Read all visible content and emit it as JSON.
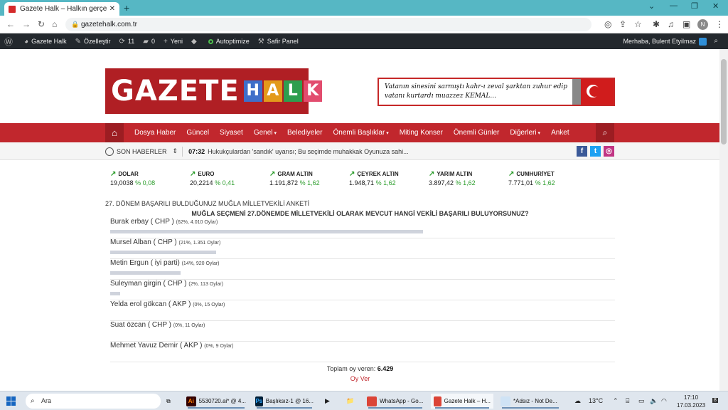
{
  "browser": {
    "tab_title": "Gazete Halk – Halkın gerçek sesi",
    "url": "gazetehalk.com.tr",
    "profile_initial": "N"
  },
  "wpbar": {
    "site": "Gazete Halk",
    "customize": "Özelleştir",
    "updates": "11",
    "comments": "0",
    "new": "Yeni",
    "autoptimize": "Autoptimize",
    "safir": "Safir Panel",
    "greeting": "Merhaba, Bulent Etyilmaz"
  },
  "logo": {
    "word1": "GAZETE",
    "letters": [
      "H",
      "A",
      "L",
      "K"
    ],
    "letter_colors": [
      "#3f6fc9",
      "#e39a1b",
      "#2e9e4f",
      "#e24c6e"
    ]
  },
  "banner": {
    "text": "Vatanın sinesini sarmıştı kahr-ı zeval şarktan zuhur edip vatanı kurtardı muazzez KEMAL..."
  },
  "nav": {
    "items": [
      "Dosya Haber",
      "Güncel",
      "Siyaset",
      "Genel",
      "Belediyeler",
      "Önemli Başlıklar",
      "Miting Konser",
      "Önemli Günler",
      "Diğerleri",
      "Anket"
    ],
    "dropdown_items": [
      "Genel",
      "Önemli Başlıklar",
      "Diğerleri"
    ]
  },
  "ticker": {
    "label": "SON HABERLER",
    "time": "07:32",
    "headline": "Hukukçulardan 'sandık' uyarısı; Bu seçimde muhakkak Oyunuza sahi..."
  },
  "markets": [
    {
      "name": "DOLAR",
      "value": "19,0038",
      "change": "% 0,08"
    },
    {
      "name": "EURO",
      "value": "20,2214",
      "change": "% 0,41"
    },
    {
      "name": "GRAM ALTIN",
      "value": "1.191,872",
      "change": "% 1,62"
    },
    {
      "name": "ÇEYREK ALTIN",
      "value": "1.948,71",
      "change": "% 1,62"
    },
    {
      "name": "YARIM ALTIN",
      "value": "3.897,42",
      "change": "% 1,62"
    },
    {
      "name": "CUMHURİYET",
      "value": "7.771,01",
      "change": "% 1,62"
    }
  ],
  "poll": {
    "title": "27. DÖNEM BAŞARILI BULDUĞUNUZ MUĞLA MİLLETVEKİLİ ANKETİ",
    "question": "MUĞLA SEÇMENİ 27.DÖNEMDE MİLLETVEKİLİ OLARAK MEVCUT HANGİ VEKİLİ BAŞARILI BULUYORSUNUZ?",
    "options": [
      {
        "label": "Burak erbay ( CHP )",
        "stats": "(62%, 4.010 Oylar)",
        "percent": 62
      },
      {
        "label": "Mursel Alban ( CHP )",
        "stats": "(21%, 1.351 Oylar)",
        "percent": 21
      },
      {
        "label": "Metin Ergun ( iyi parti)",
        "stats": "(14%, 920 Oylar)",
        "percent": 14
      },
      {
        "label": "Suleyman girgin ( CHP )",
        "stats": "(2%, 113 Oylar)",
        "percent": 2
      },
      {
        "label": "Yelda erol gökcan ( AKP )",
        "stats": "(0%, 15 Oylar)",
        "percent": 0
      },
      {
        "label": "Suat özcan ( CHP )",
        "stats": "(0%, 11 Oylar)",
        "percent": 0
      },
      {
        "label": "Mehmet Yavuz Demir ( AKP )",
        "stats": "(0%, 9 Oylar)",
        "percent": 0
      }
    ],
    "total_label": "Toplam oy veren:",
    "total_value": "6.429",
    "vote_label": "Oy Ver"
  },
  "taskbar": {
    "search": "Ara",
    "apps": [
      {
        "label": "5530720.ai* @ 4...",
        "icon": "Ai",
        "color": "#ff7c00",
        "bg": "#330000"
      },
      {
        "label": "Başlıksız-1 @ 16...",
        "icon": "Ps",
        "color": "#31a8ff",
        "bg": "#001e36"
      },
      {
        "label": "WhatsApp - Go...",
        "icon": "",
        "color": "#fff",
        "bg": "#db4437"
      },
      {
        "label": "Gazete Halk – H...",
        "icon": "",
        "color": "#fff",
        "bg": "#db4437"
      },
      {
        "label": "*Adsız - Not De...",
        "icon": "",
        "color": "#333",
        "bg": "#cfe3f5"
      }
    ],
    "temperature": "13°C",
    "time": "17:10",
    "date": "17.03.2023",
    "notifications": "8"
  }
}
